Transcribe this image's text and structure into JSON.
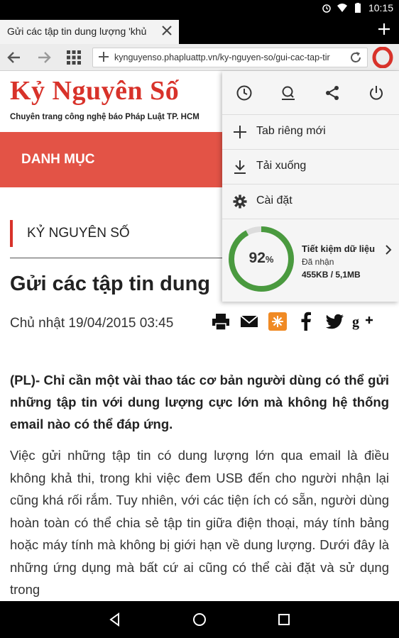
{
  "status_bar": {
    "time": "10:15"
  },
  "tab": {
    "title": "Gửi các tập tin dung lượng 'khủ"
  },
  "address_bar": {
    "url": "kynguyenso.phapluattp.vn/ky-nguyen-so/gui-cac-tap-tir"
  },
  "site": {
    "logo": "Kỷ Nguyên Số",
    "tagline": "Chuyên trang công nghệ báo Pháp Luật TP. HCM",
    "menu_label": "DANH MỤC",
    "section_label": "KỶ NGUYÊN SỐ"
  },
  "article": {
    "title": "Gửi các tập tin dung",
    "meta": "Chủ nhật 19/04/2015 03:45",
    "lead": "(PL)- Chỉ cần một vài thao tác cơ bản người dùng có thể gửi những tập tin với dung lượng cực lớn mà không hệ thống email nào có thể đáp ứng.",
    "body": "Việc gửi những tập tin có dung lượng lớn qua email là điều không khả thi, trong khi việc đem USB đến cho người nhận lại cũng khá rối rắm. Tuy nhiên, với các tiện ích có sẵn, người dùng hoàn toàn có thể chia sẻ tập tin giữa điện thoại, máy tính bảng hoặc máy tính mà không bị giới hạn về dung lượng. Dưới đây là những ứng dụng mà bất cứ ai cũng có thể cài đặt và sử dụng trong"
  },
  "opera_menu": {
    "items": [
      {
        "label": "Tab riêng mới",
        "icon": "plus-icon"
      },
      {
        "label": "Tải xuống",
        "icon": "download-icon"
      },
      {
        "label": "Cài đặt",
        "icon": "gear-icon"
      }
    ],
    "data_saver": {
      "percent": "92",
      "percent_sign": "%",
      "percent_value": 0.92,
      "title": "Tiết kiệm dữ liệu",
      "subtitle": "Đã nhận",
      "amount": "455KB / 5,1MB"
    }
  },
  "colors": {
    "brand_red": "#d8322a",
    "menu_red": "#e35346",
    "gauge_green": "#4a9a3f"
  }
}
